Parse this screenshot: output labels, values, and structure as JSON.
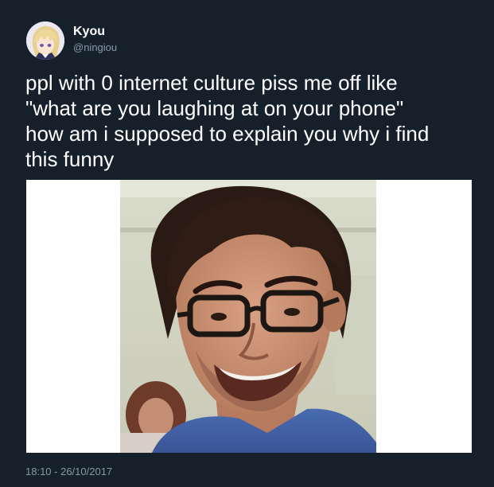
{
  "user": {
    "display_name": "Kyou",
    "handle": "@ningiou",
    "avatar_icon": "anime-avatar"
  },
  "tweet": {
    "text": "ppl with 0 internet culture piss me off like\n\"what are you laughing at on your phone\"\nhow am i supposed to explain you why i find\nthis funny",
    "timestamp": "18:10 - 26/10/2017"
  },
  "media": {
    "description_icon": "photo-smiling-man-glasses"
  },
  "colors": {
    "background": "#15202b",
    "text": "#ffffff",
    "secondary_text": "#8899a6"
  }
}
